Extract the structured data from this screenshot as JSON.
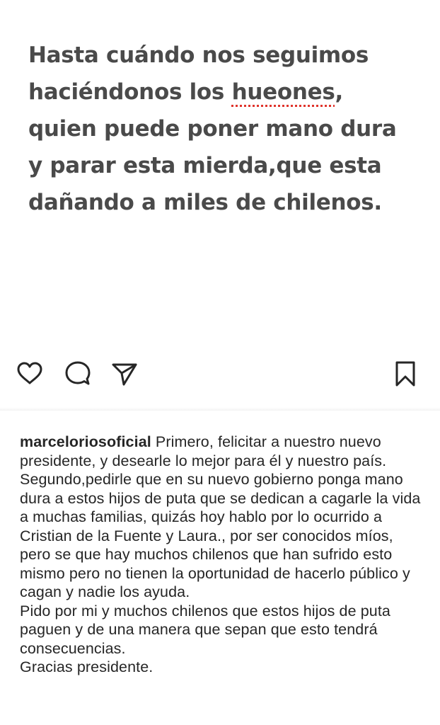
{
  "post": {
    "image_text": {
      "lines": [
        "Hasta cuándo nos seguimos",
        "haciéndonos los ",
        ",",
        "quien puede poner mano dura",
        "y parar esta mierda,que esta",
        "dañando a miles de chilenos."
      ],
      "underlined_word": "hueones"
    },
    "actions": {
      "like_icon": "heart-outline",
      "comment_icon": "speech-bubble-outline",
      "share_icon": "paper-plane-outline",
      "save_icon": "bookmark-outline"
    },
    "caption": {
      "username": "marceloriosoficial",
      "paragraphs": [
        " Primero, felicitar a nuestro nuevo presidente, y desearle lo mejor para él y nuestro país.",
        "Segundo,pedirle que en su nuevo gobierno ponga mano dura a estos hijos de puta que se dedican a cagarle la vida a muchas familias, quizás hoy hablo por lo ocurrido a Cristian de la Fuente y Laura., por ser conocidos míos, pero se que hay muchos chilenos que han sufrido esto mismo pero no tienen la oportunidad de hacerlo público y cagan y nadie los ayuda.",
        "Pido por mi y muchos chilenos que estos hijos de puta paguen y de una manera que sepan que esto tendrá consecuencias.",
        "Gracias presidente."
      ]
    }
  },
  "colors": {
    "image_text": "#4a4a4a",
    "caption_text": "#262626",
    "spellcheck_underline": "#e0342c",
    "icon_stroke": "#262626"
  }
}
